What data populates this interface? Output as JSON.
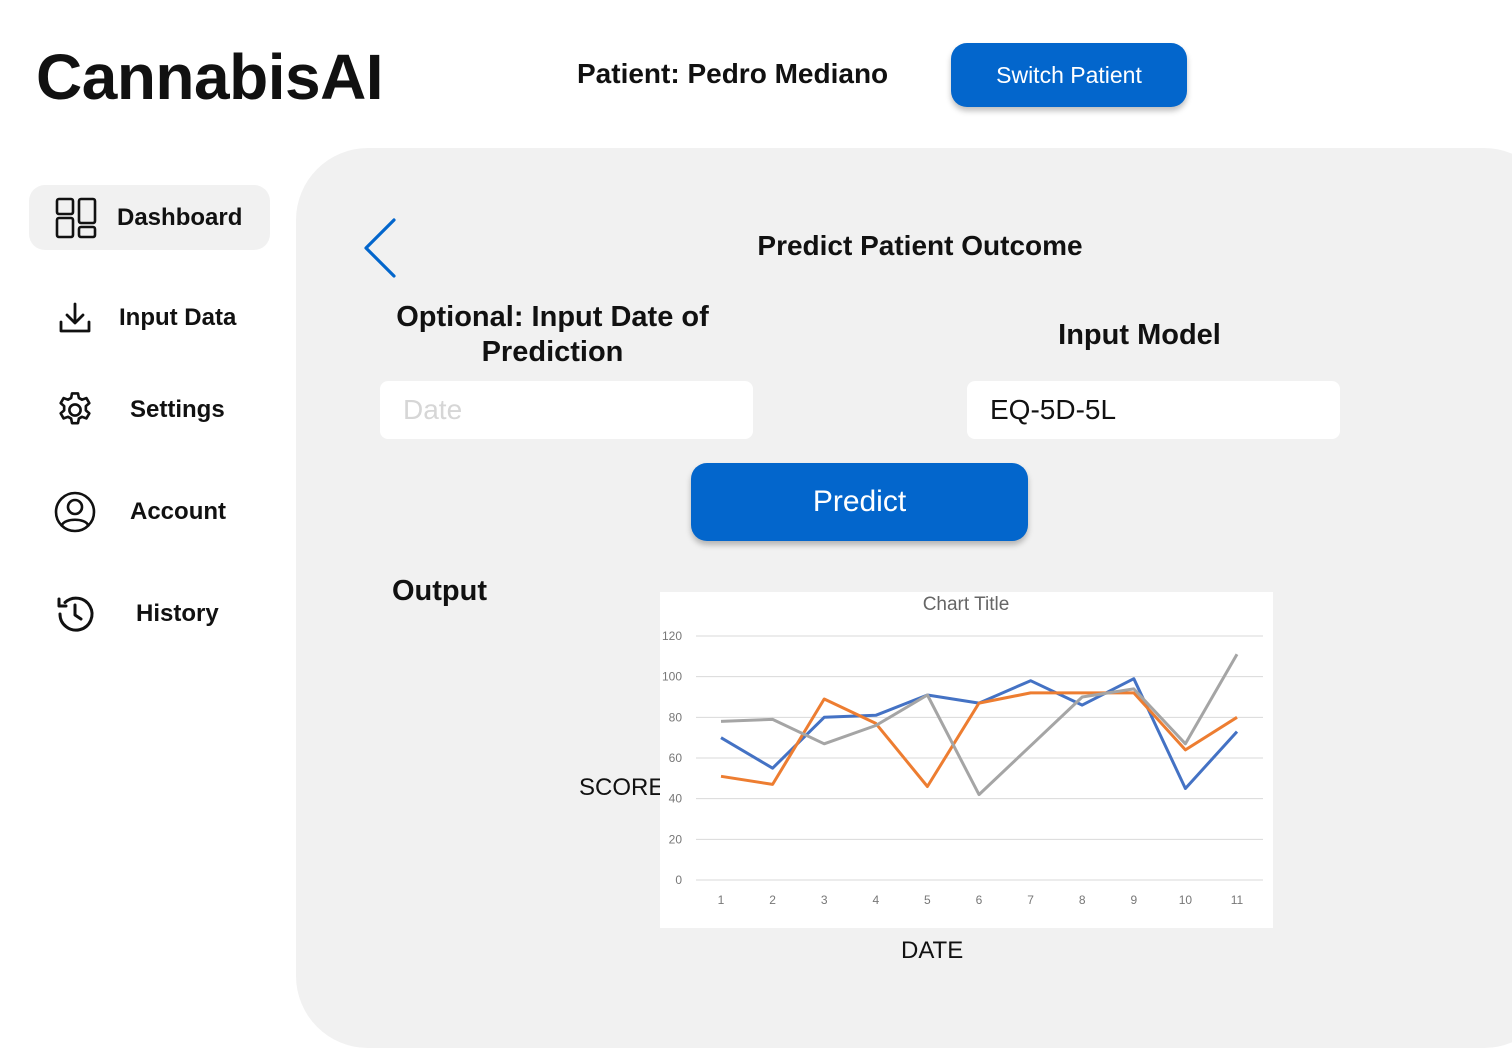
{
  "app": {
    "title": "CannabisAI"
  },
  "header": {
    "patient_label": "Patient: Pedro Mediano",
    "switch_button": "Switch Patient"
  },
  "sidebar": {
    "items": [
      {
        "label": "Dashboard",
        "icon": "dashboard-icon",
        "active": true
      },
      {
        "label": "Input Data",
        "icon": "download-icon"
      },
      {
        "label": "Settings",
        "icon": "gear-icon"
      },
      {
        "label": "Account",
        "icon": "user-circle-icon"
      },
      {
        "label": "History",
        "icon": "history-icon"
      }
    ]
  },
  "main": {
    "title": "Predict Patient Outcome",
    "date_field": {
      "label": "Optional: Input Date of Prediction",
      "placeholder": "Date",
      "value": ""
    },
    "model_field": {
      "label": "Input Model",
      "value": "EQ-5D-5L"
    },
    "predict_button": "Predict",
    "output_label": "Output",
    "y_axis_label": "SCORE",
    "x_axis_label": "DATE"
  },
  "colors": {
    "accent": "#0366cc",
    "panel": "#f1f1f1"
  },
  "chart_data": {
    "type": "line",
    "title": "Chart Title",
    "categories": [
      "1",
      "2",
      "3",
      "4",
      "5",
      "6",
      "7",
      "8",
      "9",
      "10",
      "11"
    ],
    "ylim": [
      0,
      120
    ],
    "yticks": [
      0,
      20,
      40,
      60,
      80,
      100,
      120
    ],
    "grid": true,
    "series": [
      {
        "color": "#4472c4",
        "values": [
          70,
          55,
          80,
          81,
          91,
          87,
          98,
          86,
          99,
          45,
          73
        ]
      },
      {
        "color": "#ed7d31",
        "values": [
          51,
          47,
          89,
          77,
          46,
          87,
          92,
          92,
          92,
          64,
          80
        ]
      },
      {
        "color": "#a5a5a5",
        "values": [
          78,
          79,
          67,
          76,
          91,
          42,
          66,
          90,
          94,
          67,
          111
        ]
      }
    ]
  }
}
